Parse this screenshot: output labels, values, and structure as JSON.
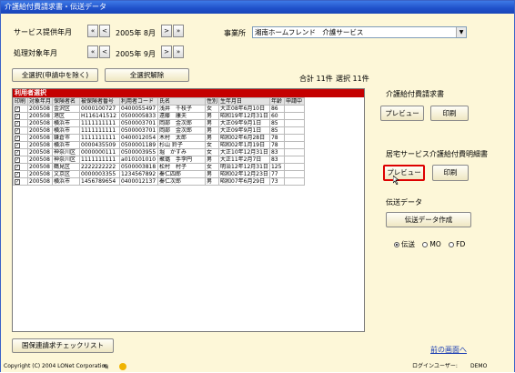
{
  "window": {
    "title": "介護給付費請求書・伝送データ"
  },
  "service_month": {
    "label": "サービス提供年月",
    "value": "2005年 8月"
  },
  "process_month": {
    "label": "処理対象年月",
    "value": "2005年 9月"
  },
  "nav": {
    "first": "«",
    "prev": "<",
    "next": ">",
    "last": "»"
  },
  "office": {
    "label": "事業所",
    "value": "湘南ホームフレンド　介護サービス"
  },
  "buttons": {
    "select_all": "全選択(申請中を除く)",
    "deselect_all": "全選択解除",
    "check_list": "国保連請求チェックリスト",
    "prev_screen": "前の画面へ"
  },
  "totals": {
    "total": "合計 11件",
    "selected": "選択 11件"
  },
  "grid": {
    "title": "利用者選択",
    "headers": [
      "印刷",
      "対象年月",
      "保険者名",
      "被保険者番号",
      "利用者コード",
      "氏名",
      "性別",
      "生年月日",
      "年齢",
      "申請中"
    ],
    "rows": [
      [
        "✓",
        "200508",
        "金沢区",
        "0000100727",
        "0400055497",
        "浅井　千枝子",
        "女",
        "大正08年6月10日",
        "86",
        ""
      ],
      [
        "✓",
        "200508",
        "港区",
        "H116141512",
        "0500005833",
        "遠藤　康夫",
        "男",
        "昭和19年12月31日",
        "60",
        ""
      ],
      [
        "✓",
        "200508",
        "横浜市",
        "1111111111",
        "0500003701",
        "岡部　金次郎",
        "男",
        "大正09年9月1日",
        "85",
        ""
      ],
      [
        "✓",
        "200508",
        "横浜市",
        "1111111111",
        "0500003701",
        "岡部　金次郎",
        "男",
        "大正09年9月1日",
        "85",
        ""
      ],
      [
        "✓",
        "200508",
        "鎌倉市",
        "1111111111",
        "0400012054",
        "木村　太郎",
        "男",
        "昭和02年6月28日",
        "78",
        ""
      ],
      [
        "✓",
        "200508",
        "横浜市",
        "0000435509",
        "0500001189",
        "杉山 鈴子",
        "女",
        "昭和02年1月19日",
        "78",
        ""
      ],
      [
        "✓",
        "200508",
        "神奈川区",
        "0000000111",
        "0500003955",
        "堀　かすみ",
        "女",
        "大正10年12月31日",
        "83",
        ""
      ],
      [
        "✓",
        "200508",
        "神奈川区",
        "1111111111",
        "a010101010",
        "聚璐　手李円",
        "男",
        "大正11年2月7日",
        "83",
        ""
      ],
      [
        "✓",
        "200508",
        "鶴見区",
        "2222222222",
        "0500003818",
        "松村　村子",
        "女",
        "明治12年12月31日",
        "125",
        ""
      ],
      [
        "✓",
        "200508",
        "文京区",
        "0000003355",
        "1234567892",
        "秦仁四郎",
        "男",
        "昭和02年12月23日",
        "77",
        ""
      ],
      [
        "✓",
        "200508",
        "横浜市",
        "1456789654",
        "0400012137",
        "秦仁次郎",
        "男",
        "昭和07年6月29日",
        "73",
        ""
      ]
    ]
  },
  "sections": {
    "invoice": {
      "title": "介護給付費請求書",
      "preview": "プレビュー",
      "print": "印刷"
    },
    "statement": {
      "title": "居宅サービス介護給付費明細書",
      "preview": "プレビュー",
      "print": "印刷"
    },
    "transfer": {
      "title": "伝送データ",
      "create": "伝送データ作成"
    }
  },
  "media": {
    "options": [
      "伝送",
      "MO",
      "FD"
    ],
    "selected": "伝送"
  },
  "status": {
    "copyright": "Copyright (C) 2004 LONet Corporation",
    "user_label": "ログインユーザー:",
    "user": "DEMO"
  },
  "colors": {
    "accent_red": "#c40000",
    "window_bg": "#fdf7d8",
    "title_blue": "#2457d2"
  }
}
